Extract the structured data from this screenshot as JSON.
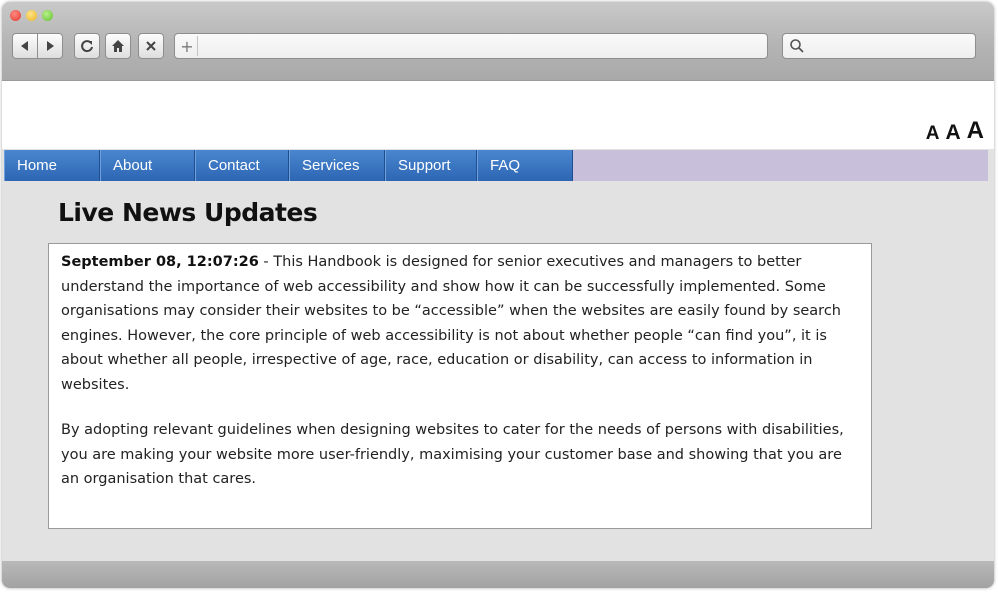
{
  "browser": {
    "address_value": "",
    "new_tab_symbol": "+",
    "search_value": "",
    "icons": [
      "back-icon",
      "forward-icon",
      "reload-icon",
      "home-icon",
      "stop-icon",
      "search-icon"
    ]
  },
  "text_size": {
    "small": "A",
    "medium": "A",
    "large": "A"
  },
  "nav": {
    "items": [
      {
        "label": "Home"
      },
      {
        "label": "About"
      },
      {
        "label": "Contact"
      },
      {
        "label": "Services"
      },
      {
        "label": "Support"
      },
      {
        "label": "FAQ"
      }
    ]
  },
  "news": {
    "title": "Live News Updates",
    "timestamp": "September 08, 12:07:26",
    "separator": " - ",
    "paragraph1": "This Handbook is designed for senior executives and managers to better understand the importance of web accessibility and show how it can be successfully implemented. Some organisations may consider their websites to be “accessible” when the websites are easily found by search engines. However, the core principle of web accessibility is not about whether people “can find you”, it is about whether all people, irrespective of age, race, education or disability, can access to information in websites.",
    "paragraph2": "By adopting relevant guidelines when designing websites to cater for the needs of persons with disabilities, you are making your website more user-friendly, maximising your customer base and showing that you are an organisation that cares."
  },
  "colors": {
    "nav_blue": "#3a76c2",
    "nav_strip": "#c8c0da",
    "page_bg": "#e2e2e2"
  }
}
